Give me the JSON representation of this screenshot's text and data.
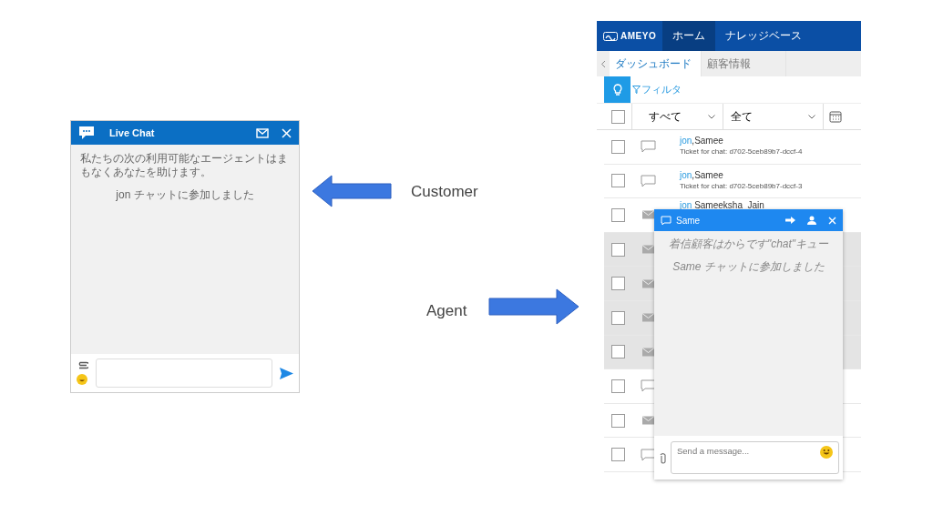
{
  "customer_chat": {
    "title": "Live Chat",
    "messages": [
      {
        "kind": "info",
        "text": "私たちの次の利用可能なエージェントはまもなくあなたを助けます。"
      },
      {
        "kind": "center",
        "text": "jon チャットに参加しました"
      }
    ]
  },
  "labels": {
    "customer": "Customer",
    "agent": "Agent"
  },
  "agent_app": {
    "logo": "AMEYO",
    "nav": [
      {
        "label": "ホーム",
        "selected": true
      },
      {
        "label": "ナレッジベース",
        "selected": false
      }
    ],
    "tabs": [
      {
        "label": "ダッシュボード",
        "selected": true
      },
      {
        "label": "顧客情報",
        "selected": false
      }
    ],
    "filter": "フィルタ",
    "select_all_checked": false,
    "dropdowns": [
      "すべて",
      "全て"
    ],
    "rows": [
      {
        "kind": "chat",
        "checked": false,
        "highlighted": false,
        "name_link": "jon",
        "name": ",Samee",
        "subtitle": "Ticket for chat: d702-5ceb89b7-dccf-4"
      },
      {
        "kind": "chat",
        "checked": false,
        "highlighted": false,
        "name_link": "jon",
        "name": ",Samee",
        "subtitle": "Ticket for chat: d702-5ceb89b7-dccf-3"
      },
      {
        "kind": "mail",
        "checked": false,
        "highlighted": false,
        "name_link": "jon",
        "name": " Sameeksha_Jain"
      },
      {
        "kind": "mail",
        "checked": false,
        "highlighted": true
      },
      {
        "kind": "mail",
        "checked": false,
        "highlighted": true
      },
      {
        "kind": "mail",
        "checked": false,
        "highlighted": true
      },
      {
        "kind": "mail",
        "checked": false,
        "highlighted": true
      },
      {
        "kind": "chat",
        "checked": false,
        "highlighted": false
      },
      {
        "kind": "mail",
        "checked": false,
        "highlighted": false
      },
      {
        "kind": "chat",
        "checked": false,
        "highlighted": false
      }
    ],
    "chat_popup": {
      "title": "Same",
      "messages": [
        "着信顧客はからです\"chat\"キュー",
        "Same チャットに参加しました"
      ],
      "placeholder": "Send a message..."
    }
  }
}
